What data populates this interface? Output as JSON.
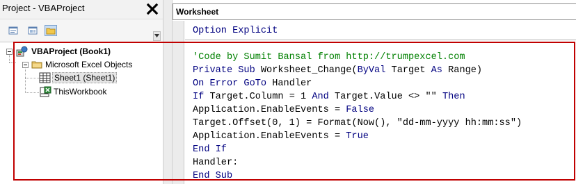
{
  "project_pane": {
    "title": "Project - VBAProject",
    "close_glyph": "✖",
    "toolbar": [
      {
        "icon": "view-code-icon"
      },
      {
        "icon": "view-object-icon"
      },
      {
        "icon": "toggle-folders-icon",
        "active": true
      }
    ],
    "tree": {
      "root": {
        "label": "VBAProject (Book1)",
        "icon": "vba-project-icon",
        "expanded": true
      },
      "folder": {
        "label": "Microsoft Excel Objects",
        "icon": "folder-icon",
        "expanded": true
      },
      "items": [
        {
          "label": "Sheet1 (Sheet1)",
          "icon": "worksheet-icon",
          "selected": true
        },
        {
          "label": "ThisWorkbook",
          "icon": "workbook-icon",
          "selected": false
        }
      ]
    }
  },
  "code_window": {
    "object_combo": "Worksheet",
    "declarations": "Option Explicit",
    "lines": [
      {
        "parts": [
          {
            "t": "'Code by Sumit Bansal from http://trumpexcel.com",
            "c": "comment"
          }
        ]
      },
      {
        "parts": [
          {
            "t": "Private Sub",
            "c": "keyword"
          },
          {
            "t": " Worksheet_Change(",
            "c": "plain"
          },
          {
            "t": "ByVal",
            "c": "keyword"
          },
          {
            "t": " Target ",
            "c": "plain"
          },
          {
            "t": "As",
            "c": "keyword"
          },
          {
            "t": " Range)",
            "c": "plain"
          }
        ]
      },
      {
        "parts": [
          {
            "t": "On Error GoTo",
            "c": "keyword"
          },
          {
            "t": " Handler",
            "c": "plain"
          }
        ]
      },
      {
        "parts": [
          {
            "t": "If",
            "c": "keyword"
          },
          {
            "t": " Target.Column = 1 ",
            "c": "plain"
          },
          {
            "t": "And",
            "c": "keyword"
          },
          {
            "t": " Target.Value <> \"\" ",
            "c": "plain"
          },
          {
            "t": "Then",
            "c": "keyword"
          }
        ]
      },
      {
        "parts": [
          {
            "t": "Application.EnableEvents = ",
            "c": "plain"
          },
          {
            "t": "False",
            "c": "keyword"
          }
        ]
      },
      {
        "parts": [
          {
            "t": "Target.Offset(0, 1) = Format(Now(), \"dd-mm-yyyy hh:mm:ss\")",
            "c": "plain"
          }
        ]
      },
      {
        "parts": [
          {
            "t": "Application.EnableEvents = ",
            "c": "plain"
          },
          {
            "t": "True",
            "c": "keyword"
          }
        ]
      },
      {
        "parts": [
          {
            "t": "End If",
            "c": "keyword"
          }
        ]
      },
      {
        "parts": [
          {
            "t": "Handler:",
            "c": "plain"
          }
        ]
      },
      {
        "parts": [
          {
            "t": "End Sub",
            "c": "keyword"
          }
        ]
      }
    ]
  },
  "colors": {
    "keyword": "#000080",
    "comment": "#008000",
    "highlight_border": "#c00000"
  }
}
